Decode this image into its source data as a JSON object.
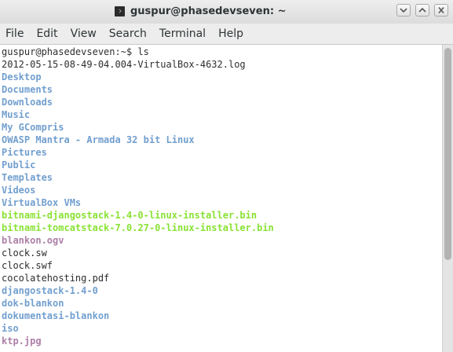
{
  "window": {
    "title": "guspur@phasedevseven: ~",
    "icon": "terminal-icon",
    "buttons": [
      "minimize-icon",
      "maximize-icon",
      "close-icon"
    ]
  },
  "menu": [
    "File",
    "Edit",
    "View",
    "Search",
    "Terminal",
    "Help"
  ],
  "terminal": {
    "prompt": "guspur@phasedevseven:~$ ls",
    "entries": [
      {
        "text": "2012-05-15-08-49-04.004-VirtualBox-4632.log",
        "kind": "file"
      },
      {
        "text": "Desktop",
        "kind": "dir"
      },
      {
        "text": "Documents",
        "kind": "dir"
      },
      {
        "text": "Downloads",
        "kind": "dir"
      },
      {
        "text": "Music",
        "kind": "dir"
      },
      {
        "text": "My GCompris",
        "kind": "dir"
      },
      {
        "text": "OWASP Mantra - Armada 32 bit Linux",
        "kind": "dir"
      },
      {
        "text": "Pictures",
        "kind": "dir"
      },
      {
        "text": "Public",
        "kind": "dir"
      },
      {
        "text": "Templates",
        "kind": "dir"
      },
      {
        "text": "Videos",
        "kind": "dir"
      },
      {
        "text": "VirtualBox VMs",
        "kind": "dir"
      },
      {
        "text": "bitnami-djangostack-1.4-0-linux-installer.bin",
        "kind": "exec"
      },
      {
        "text": "bitnami-tomcatstack-7.0.27-0-linux-installer.bin",
        "kind": "exec"
      },
      {
        "text": "blankon.ogv",
        "kind": "media"
      },
      {
        "text": "clock.sw",
        "kind": "file"
      },
      {
        "text": "clock.swf",
        "kind": "file"
      },
      {
        "text": "cocolatehosting.pdf",
        "kind": "file"
      },
      {
        "text": "djangostack-1.4-0",
        "kind": "dir"
      },
      {
        "text": "dok-blankon",
        "kind": "dir"
      },
      {
        "text": "dokumentasi-blankon",
        "kind": "dir"
      },
      {
        "text": "iso",
        "kind": "dir"
      },
      {
        "text": "ktp.jpg",
        "kind": "media"
      }
    ]
  },
  "colors": {
    "directory": "#729fcf",
    "executable": "#8ae234",
    "media": "#ad7fa8",
    "text": "#2e2e2e"
  }
}
